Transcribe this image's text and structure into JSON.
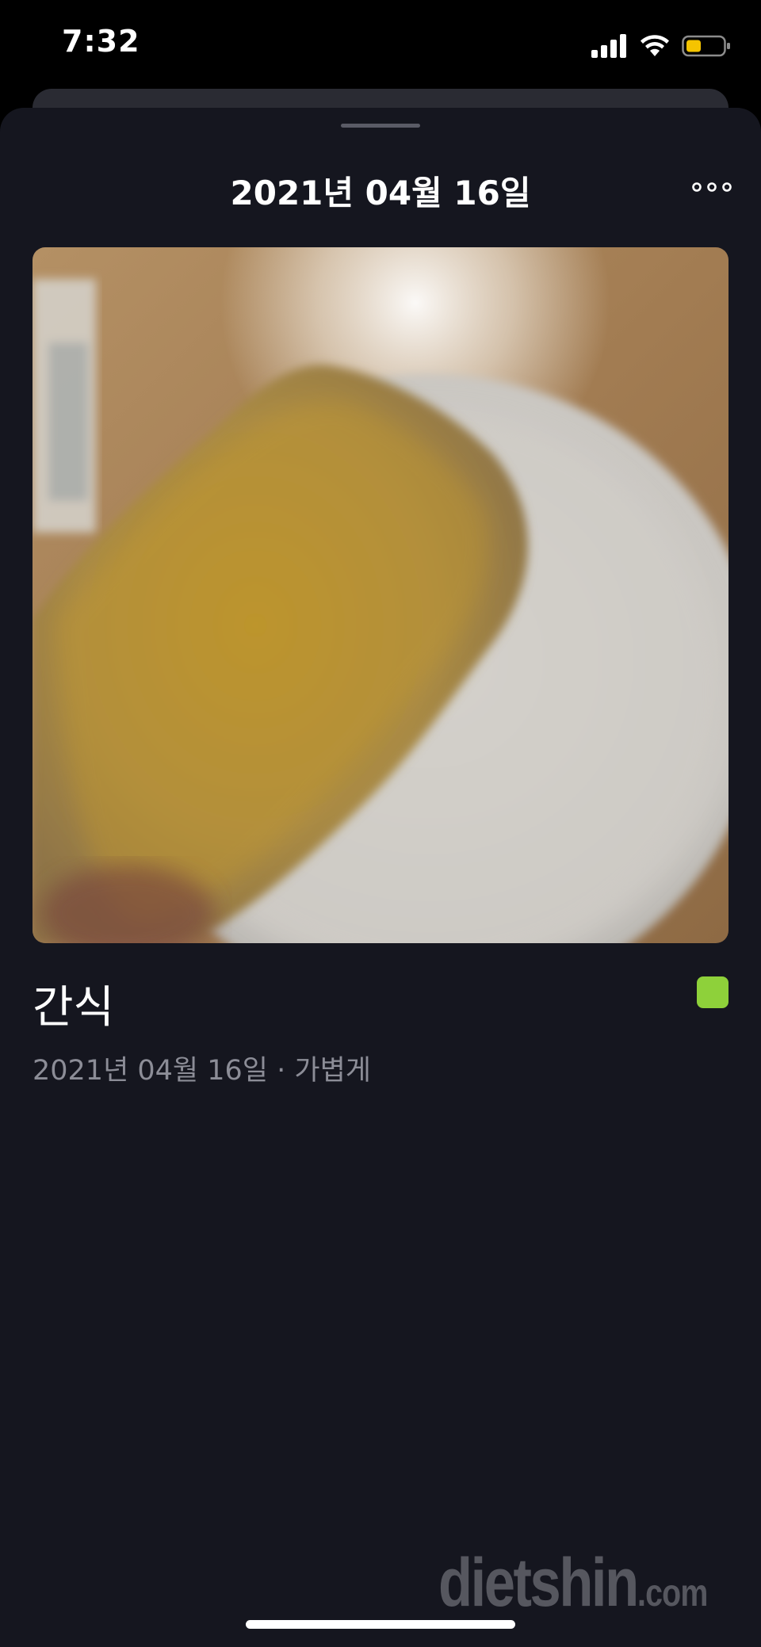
{
  "status_bar": {
    "time": "7:32",
    "battery_color": "#f5c400"
  },
  "sheet": {
    "title": "2021년 04월 16일",
    "more_icon": "ellipsis-icon"
  },
  "entry": {
    "photo_icon": "food-photo",
    "meal_type": "간식",
    "meta_date": "2021년 04월 16일",
    "meta_separator": " · ",
    "meta_amount": "가볍게",
    "status_color": "#8ed13a"
  },
  "watermark": {
    "main": "dietshin",
    "tld": ".com"
  },
  "colors": {
    "sheet_bg": "#15161f",
    "meta_text": "#8c8d97"
  }
}
